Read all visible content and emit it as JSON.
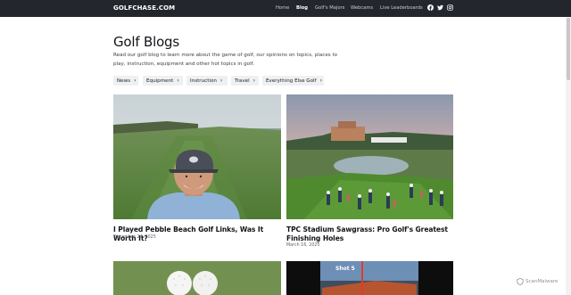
{
  "header": {
    "logo": "GOLFCHASE.COM",
    "nav": [
      {
        "label": "Home"
      },
      {
        "label": "Blog"
      },
      {
        "label": "Golf's Majors"
      },
      {
        "label": "Webcams"
      },
      {
        "label": "Live Leaderboards"
      }
    ],
    "social_icons": [
      "facebook-icon",
      "twitter-icon",
      "instagram-icon"
    ]
  },
  "page": {
    "title": "Golf Blogs",
    "description": "Read our golf blog to learn more about the game of golf, our opinions on topics, places to play, instruction, equipment and other hot topics in golf."
  },
  "categories": [
    {
      "label": "News"
    },
    {
      "label": "Equipment"
    },
    {
      "label": "Instruction"
    },
    {
      "label": "Travel"
    },
    {
      "label": "Everything Else Golf"
    }
  ],
  "posts": [
    {
      "title": "I Played Pebble Beach Golf Links, Was It Worth It?",
      "date": "December 24, 2025"
    },
    {
      "title": "TPC Stadium Sawgrass: Pro Golf's Greatest Finishing Holes",
      "date": "March 16, 2025"
    }
  ],
  "video_overlay": {
    "label": "Shot 5"
  },
  "watermark": {
    "label": "ScanMalware"
  },
  "colors": {
    "topbar": "#23272d",
    "chip_bg": "#eef0f2"
  }
}
